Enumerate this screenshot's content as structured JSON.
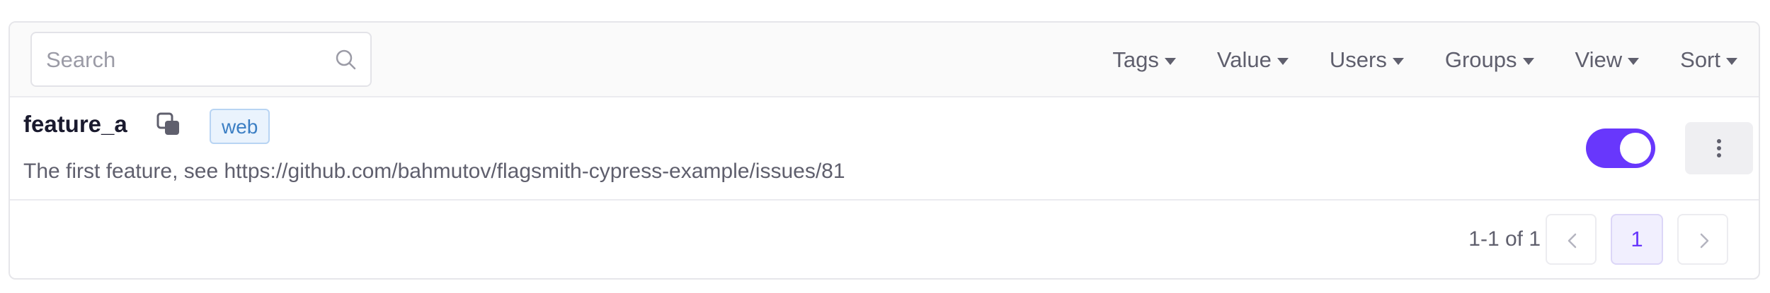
{
  "search": {
    "placeholder": "Search",
    "value": ""
  },
  "filters": {
    "tags": "Tags",
    "value": "Value",
    "users": "Users",
    "groups": "Groups",
    "view": "View",
    "sort": "Sort"
  },
  "feature": {
    "name": "feature_a",
    "tag": "web",
    "description": "The first feature, see https://github.com/bahmutov/flagsmith-cypress-example/issues/81",
    "enabled": true
  },
  "pagination": {
    "info": "1-1 of 1",
    "current_page": "1"
  },
  "colors": {
    "accent": "#6837fc",
    "tag_text": "#3c7fc4",
    "tag_bg": "#eaf3fd"
  },
  "icons": {
    "search": "search-icon",
    "copy": "copy-icon",
    "more": "more-vertical-icon",
    "prev": "chevron-left-icon",
    "next": "chevron-right-icon"
  }
}
